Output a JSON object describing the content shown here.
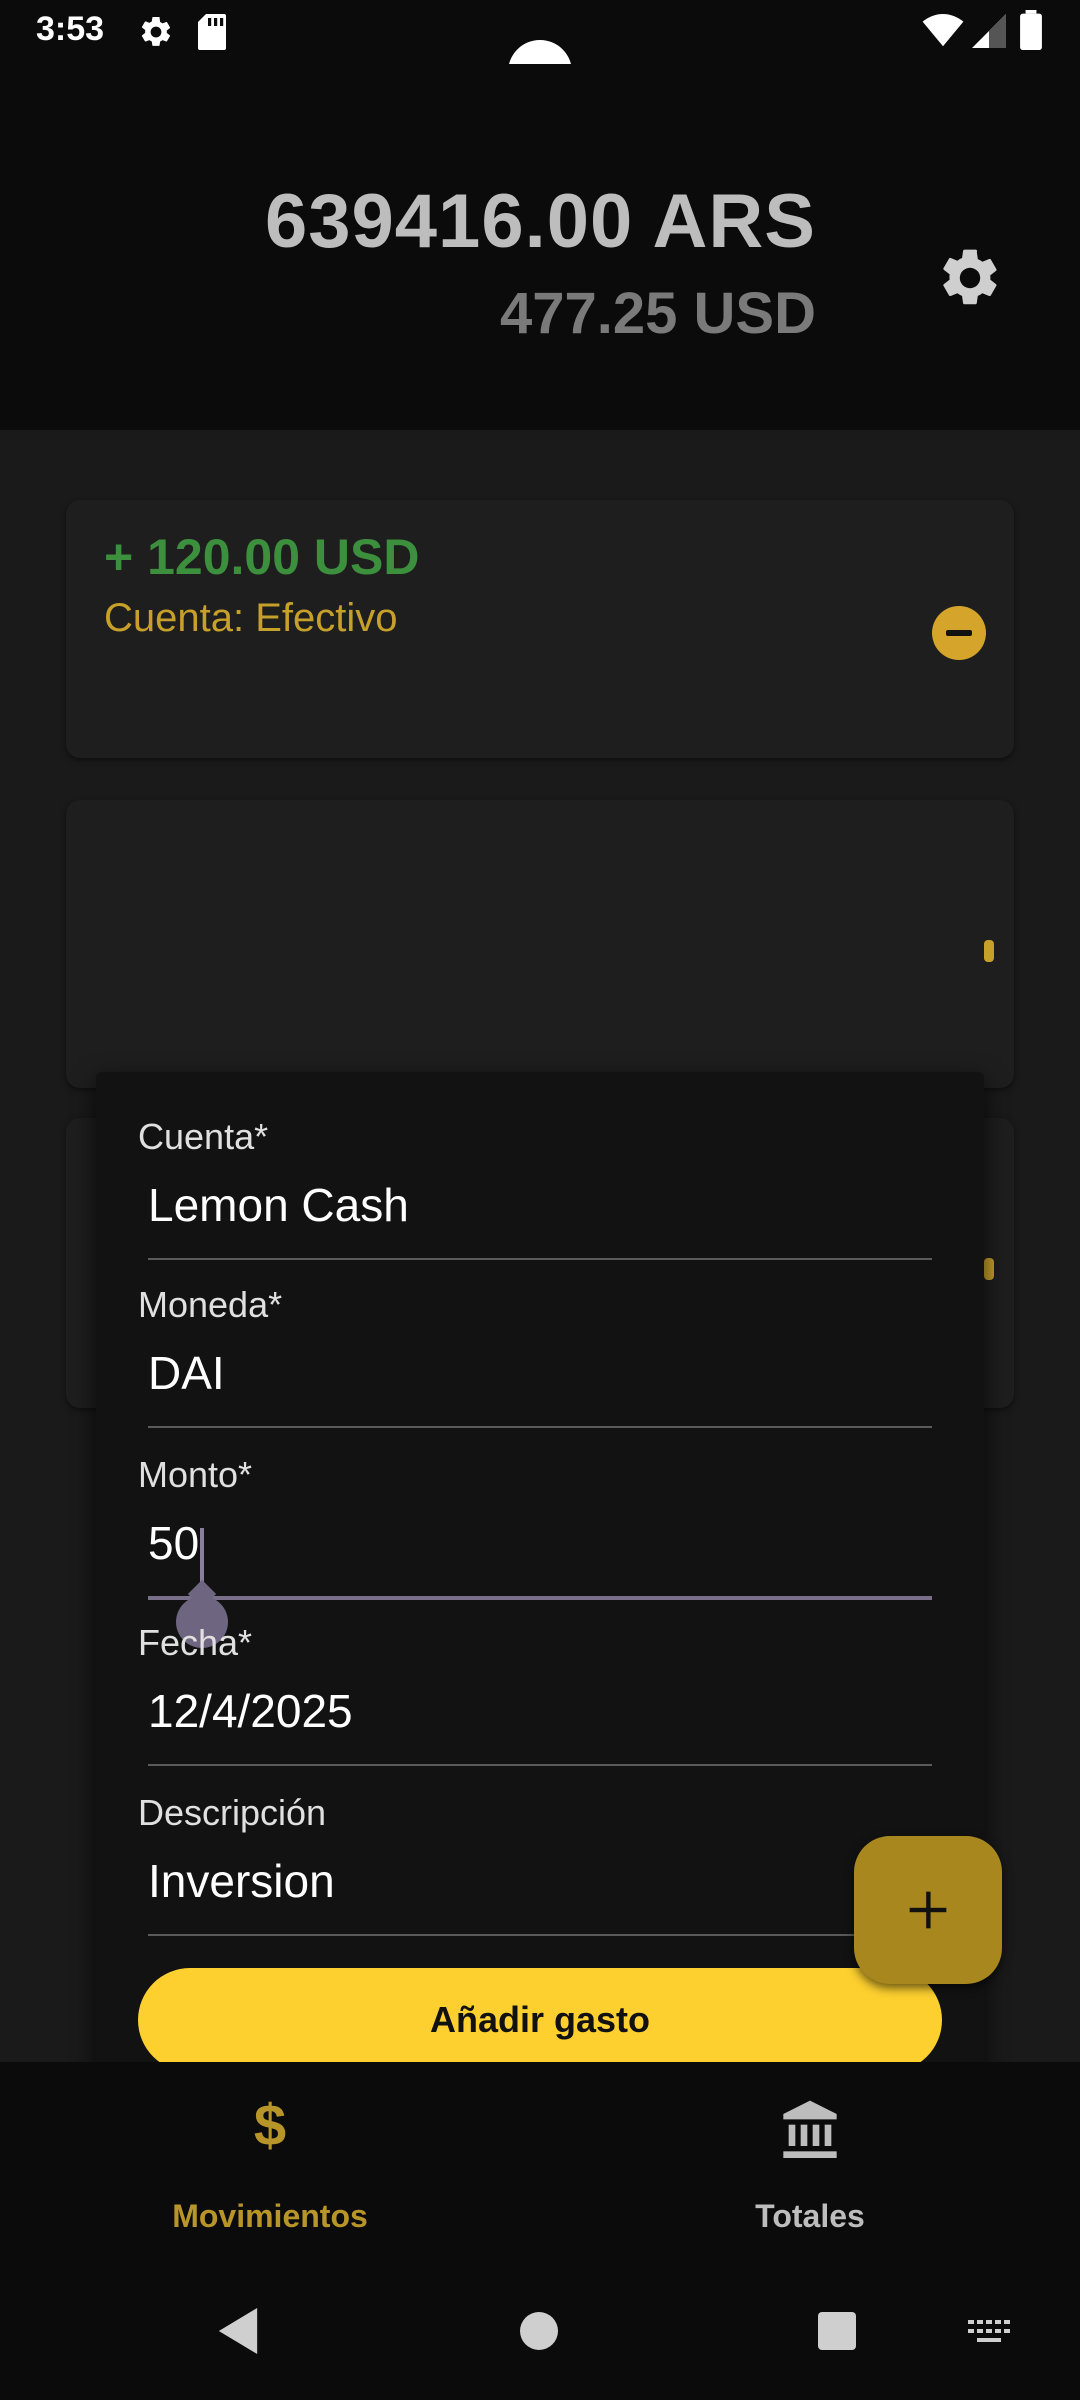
{
  "status_bar": {
    "time": "3:53",
    "icons": [
      "gear-icon",
      "sd-card-icon",
      "wifi-icon",
      "signal-icon",
      "battery-icon"
    ]
  },
  "header": {
    "balance_ars": "639416.00  ARS",
    "balance_usd": "477.25  USD",
    "settings_icon": "gear-icon"
  },
  "movements": [
    {
      "amount": "+ 120.00  USD",
      "account": "Cuenta: Efectivo",
      "action_icon": "minus-circle-icon"
    }
  ],
  "dialog": {
    "fields": [
      {
        "label": "Cuenta*",
        "value": "Lemon Cash"
      },
      {
        "label": "Moneda*",
        "value": "DAI"
      },
      {
        "label": "Monto*",
        "value": "50"
      },
      {
        "label": "Fecha*",
        "value": "12/4/2025"
      },
      {
        "label": "Descripción",
        "value": "Inversion"
      }
    ],
    "submit_label": "Añadir gasto"
  },
  "fab": {
    "icon": "plus-icon"
  },
  "bottom_nav": {
    "items": [
      {
        "label": "Movimientos",
        "icon": "dollar-icon",
        "active": true
      },
      {
        "label": "Totales",
        "icon": "bank-icon",
        "active": false
      }
    ]
  },
  "colors": {
    "accent": "#fdd02f",
    "positive": "#3c8f3c",
    "account_text": "#c7a02a",
    "nav_active": "#b89528"
  }
}
